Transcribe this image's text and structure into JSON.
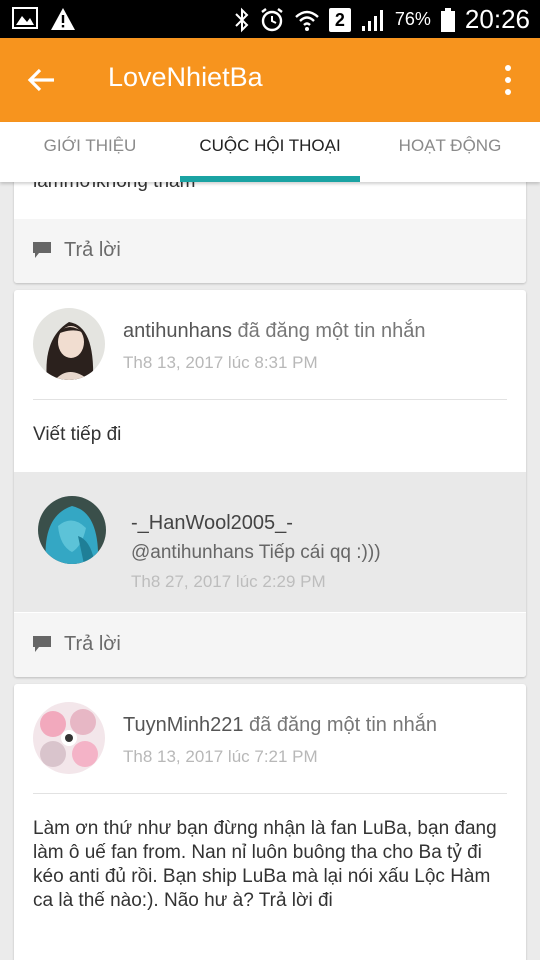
{
  "status_bar": {
    "battery_percent": "76%",
    "sim_slot": "2",
    "time": "20:26",
    "icons": [
      "image-icon",
      "warning-icon",
      "bluetooth-icon",
      "alarm-icon",
      "wifi-icon",
      "signal-icon",
      "battery-icon"
    ]
  },
  "app_bar": {
    "title": "LoveNhietBa",
    "back_icon": "arrow-left-icon",
    "menu_icon": "more-vert-icon",
    "color": "#f7941e"
  },
  "tabs": [
    {
      "label": "GIỚI THIỆU",
      "active": false
    },
    {
      "label": "CUỘC HỘI THOẠI",
      "active": true
    },
    {
      "label": "HOẠT ĐỘNG",
      "active": false
    }
  ],
  "accent_color": "#1aa3a3",
  "posts": [
    {
      "partial_text": "lắmmờikhông thấm",
      "reply_label": "Trả lời"
    },
    {
      "author": "antihunhans",
      "action": "đã đăng một tin nhắn",
      "timestamp": "Th8 13, 2017 lúc 8:31 PM",
      "message": "Viết tiếp đi",
      "nested_reply": {
        "author": "-_HanWool2005_-",
        "text": "@antihunhans Tiếp cái qq :)))",
        "timestamp": "Th8 27, 2017 lúc 2:29 PM"
      },
      "reply_label": "Trả lời"
    },
    {
      "author": "TuynMinh221",
      "action": "đã đăng một tin nhắn",
      "timestamp": "Th8 13, 2017 lúc 7:21 PM",
      "message": "Làm ơn thứ như bạn đừng nhận là fan LuBa, bạn đang làm ô uế fan from. Nan nỉ luôn buông tha cho Ba tỷ đi kéo anti đủ rồi. Bạn ship LuBa mà lại nói xấu Lộc Hàm ca là thế nào:). Não hư à? Trả lời đi"
    }
  ]
}
